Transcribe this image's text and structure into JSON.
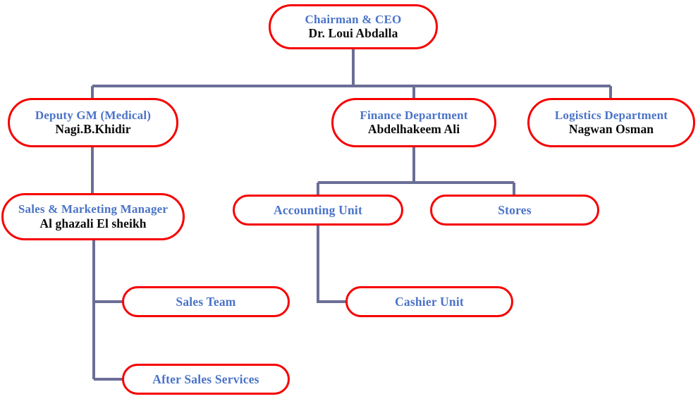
{
  "chart": {
    "kind": "organization-chart",
    "colors": {
      "node_border": "#f60000",
      "node_fill": "#ffffff",
      "title_text": "#4a73c8",
      "person_text": "#0a0a0a",
      "connector": "#6b6e96"
    }
  },
  "nodes": {
    "chairman": {
      "title": "Chairman & CEO",
      "person": "Dr. Loui Abdalla"
    },
    "deputy_gm": {
      "title": "Deputy GM (Medical)",
      "person": "Nagi.B.Khidir"
    },
    "finance": {
      "title": "Finance Department",
      "person": "Abdelhakeem Ali"
    },
    "logistics": {
      "title": "Logistics Department",
      "person": "Nagwan Osman"
    },
    "sales_marketing": {
      "title": "Sales & Marketing Manager",
      "person": "Al ghazali El sheikh"
    },
    "accounting": {
      "title": "Accounting Unit"
    },
    "stores": {
      "title": "Stores"
    },
    "sales_team": {
      "title": "Sales Team"
    },
    "cashier": {
      "title": "Cashier Unit"
    },
    "after_sales": {
      "title": "After Sales Services"
    }
  }
}
